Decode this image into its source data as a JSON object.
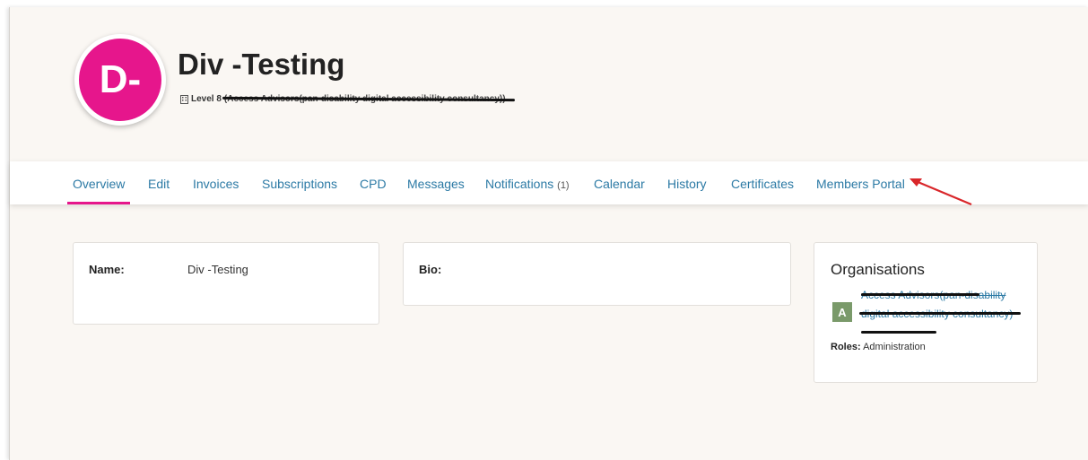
{
  "profile": {
    "avatar_initials": "D-",
    "avatar_color": "#e6168c",
    "name": "Div -Testing",
    "level": "Level 8",
    "org_struck": "(Access Advisors(pan-disability digital accessibility consultancy))"
  },
  "tabs": [
    {
      "label": "Overview",
      "active": true
    },
    {
      "label": "Edit"
    },
    {
      "label": "Invoices"
    },
    {
      "label": "Subscriptions"
    },
    {
      "label": "CPD"
    },
    {
      "label": "Messages"
    },
    {
      "label": "Notifications",
      "count": "(1)"
    },
    {
      "label": "Calendar"
    },
    {
      "label": "History"
    },
    {
      "label": "Certificates"
    },
    {
      "label": "Members Portal"
    }
  ],
  "details": {
    "name_label": "Name:",
    "name_value": "Div -Testing",
    "bio_label": "Bio:"
  },
  "organisations": {
    "title": "Organisations",
    "badge": "A",
    "org_name": "Access Advisors(pan-disability digital accessibility consultancy)",
    "roles_label": "Roles:",
    "roles_value": "Administration"
  },
  "colors": {
    "accent": "#e6168c",
    "link": "#2c7aa5",
    "annotation_arrow": "#d9262a"
  },
  "icons": {
    "building": "building-icon",
    "arrow": "annotation-arrow-icon"
  }
}
